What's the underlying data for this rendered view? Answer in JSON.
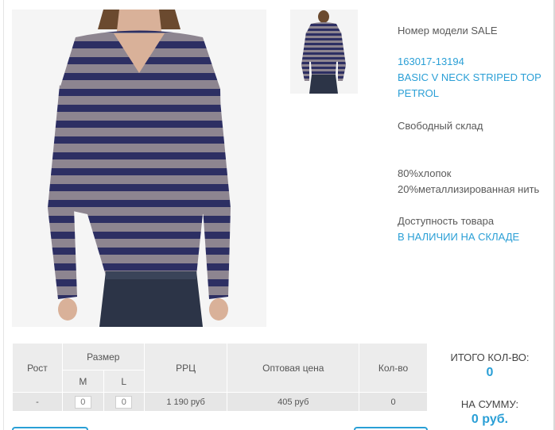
{
  "product": {
    "model_label": "Номер модели SALE",
    "code": "163017-13194",
    "name": "BASIC V NECK STRIPED TOP PETROL",
    "warehouse": "Свободный склад",
    "composition_1": "80%хлопок",
    "composition_2": "20%металлизированная нить",
    "availability_label": "Доступность товара",
    "availability_value": "В НАЛИЧИИ НА СКЛАДЕ"
  },
  "table": {
    "headers": {
      "height": "Рост",
      "size": "Размер",
      "size_m": "M",
      "size_l": "L",
      "rrp": "РРЦ",
      "wholesale": "Оптовая цена",
      "qty": "Кол-во"
    },
    "row": {
      "height": "-",
      "qty_m": "0",
      "qty_l": "0",
      "rrp": "1 190 руб",
      "wholesale": "405 руб",
      "qty": "0"
    }
  },
  "totals": {
    "count_label": "ИТОГО КОЛ-ВО:",
    "count_value": "0",
    "sum_label": "НА СУММУ:",
    "sum_value": "0 руб."
  },
  "colors": {
    "accent": "#2a9fd6",
    "stripe_dark": "#2d2f63",
    "stripe_light": "#8d8590"
  },
  "icons": {
    "main_photo": "product-photo",
    "thumbnail": "product-thumbnail"
  }
}
